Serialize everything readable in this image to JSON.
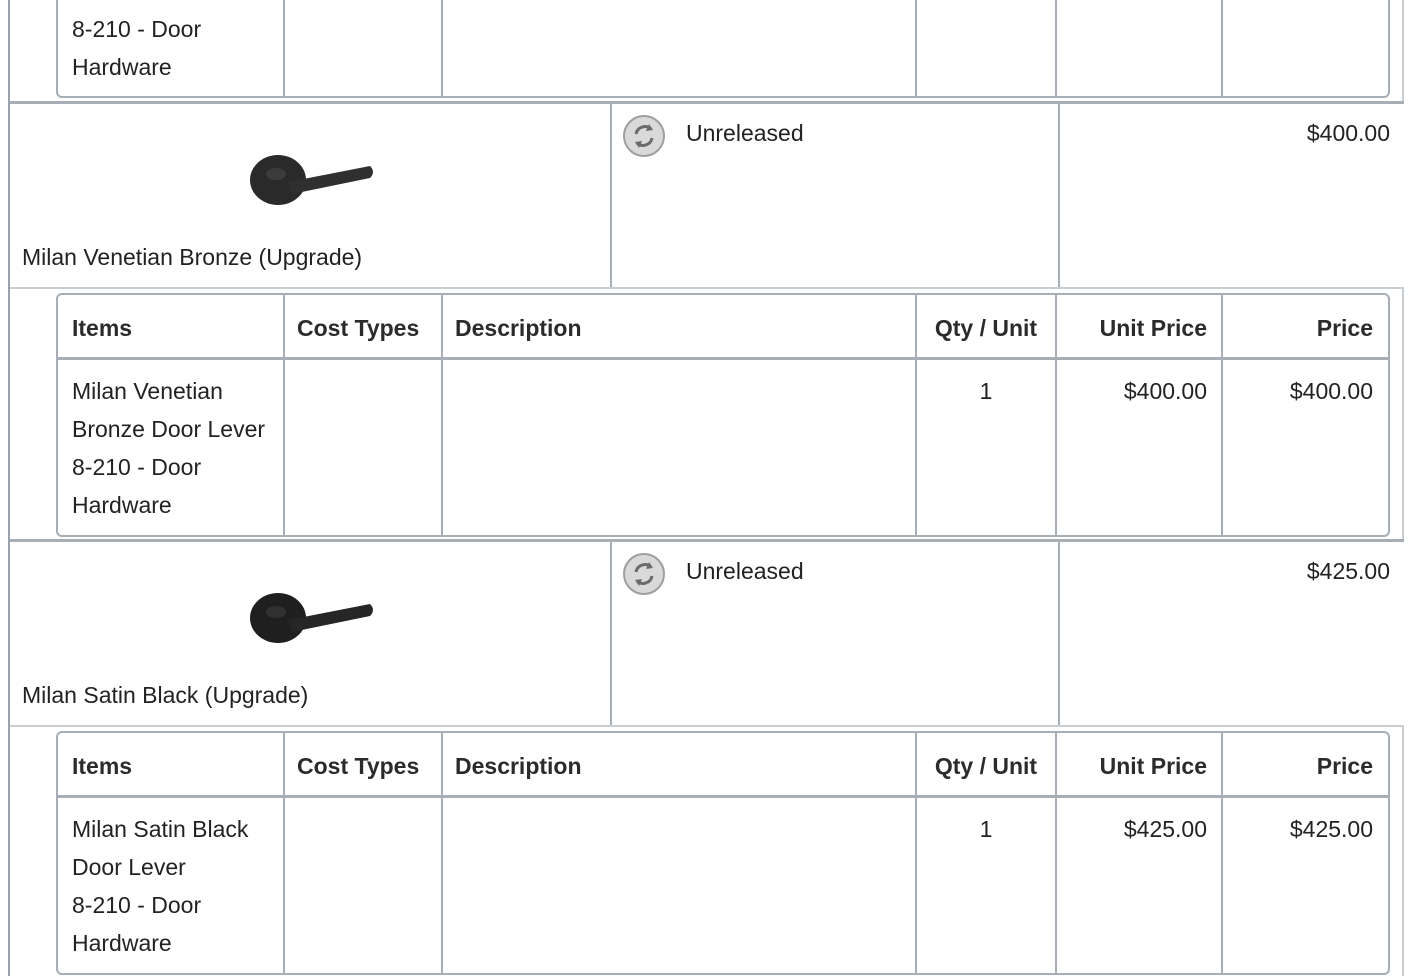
{
  "table_headers": {
    "items": "Items",
    "cost_types": "Cost Types",
    "description": "Description",
    "qty_unit": "Qty / Unit",
    "unit_price": "Unit Price",
    "price": "Price"
  },
  "top_partial": {
    "item_lines": [
      "8-210 - Door",
      "Hardware"
    ]
  },
  "options": [
    {
      "name": "Milan Venetian Bronze (Upgrade)",
      "status": "Unreleased",
      "price": "$400.00",
      "item": {
        "lines": [
          "Milan Venetian",
          "Bronze Door Lever",
          "8-210 - Door",
          "Hardware"
        ],
        "qty": "1",
        "unit_price": "$400.00",
        "price": "$400.00"
      }
    },
    {
      "name": "Milan Satin Black (Upgrade)",
      "status": "Unreleased",
      "price": "$425.00",
      "item": {
        "lines": [
          "Milan Satin Black",
          "Door Lever",
          "8-210 - Door",
          "Hardware"
        ],
        "qty": "1",
        "unit_price": "$425.00",
        "price": "$425.00"
      }
    }
  ],
  "icons": {
    "status": "refresh-icon",
    "product": "door-lever-image"
  },
  "colors": {
    "border": "#a7aeb5",
    "status_icon_bg": "#d9d9d9",
    "status_icon_fg": "#6b6b6b",
    "lever": "#2a2a2a"
  }
}
